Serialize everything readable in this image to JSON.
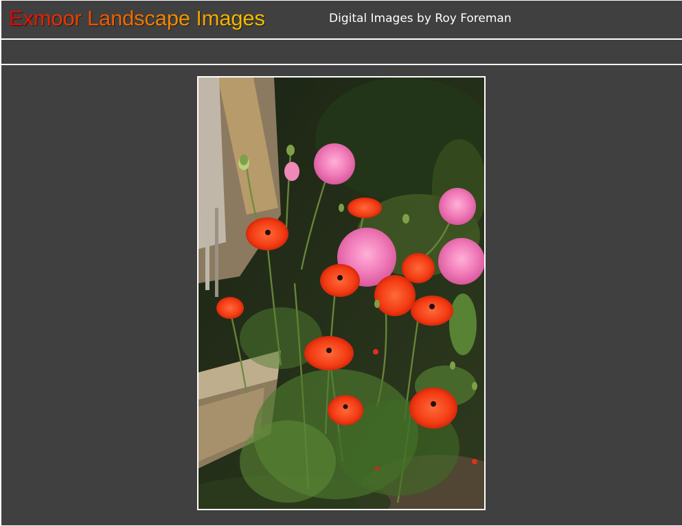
{
  "header": {
    "title": "Exmoor Landscape Images",
    "tagline": "Digital Images by Roy Foreman"
  },
  "photo": {
    "subject": "poppies-photo"
  },
  "colors": {
    "background": "#404040",
    "divider": "#ffffff",
    "title_gradient_start": "#e00000",
    "title_gradient_end": "#f6c000",
    "tagline": "#ffffff"
  }
}
